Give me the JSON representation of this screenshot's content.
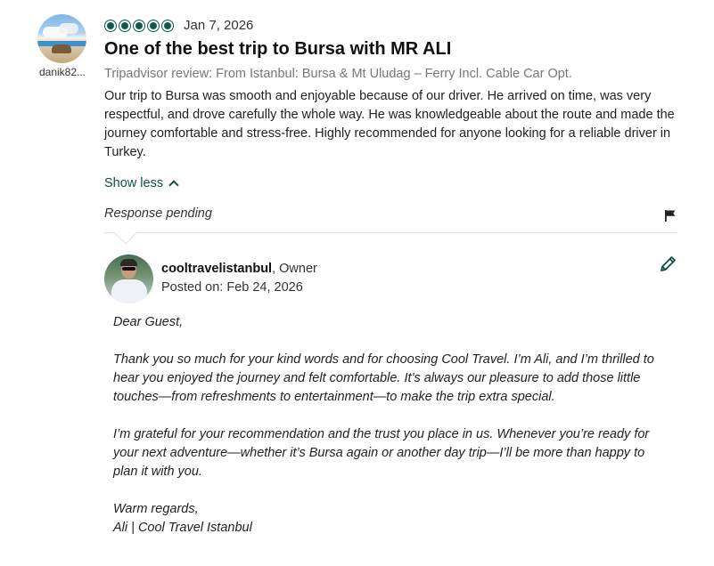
{
  "review": {
    "username": "danik82...",
    "rating": 5,
    "date": "Jan 7, 2026",
    "title": "One of the best trip to Bursa with MR ALI",
    "subtitle": "Tripadvisor review: From Istanbul: Bursa & Mt Uludag – Ferry Incl. Cable Car Opt.",
    "text": "Our trip to Bursa was smooth and enjoyable because of our driver. He arrived on time, was very respectful, and drove carefully the whole way. He was knowledgeable about the route and made the journey comfortable and stress-free. Highly recommended for anyone looking for a reliable driver in Turkey.",
    "show_less_label": "Show less",
    "status": "Response pending"
  },
  "owner_response": {
    "name": "cooltravelistanbul",
    "role": ", Owner",
    "posted": "Posted on: Feb 24, 2026",
    "paragraphs": [
      "Dear Guest,",
      "Thank you so much for your kind words and for choosing Cool Travel. I’m Ali, and I’m thrilled to hear you enjoyed the journey and felt comfortable. It’s always our pleasure to add those little touches—from refreshments to entertainment—to make the trip extra special.",
      "I’m grateful for your recommendation and the trust you place in us. Whenever you’re ready for your next adventure—whether it’s Bursa again or another day trip—I’ll be more than happy to plan it with you.",
      "Warm regards,\nAli | Cool Travel Istanbul"
    ]
  },
  "icons": {
    "flag": "flag-icon",
    "edit": "pencil-icon",
    "chevron": "chevron-up-icon"
  },
  "colors": {
    "accent": "#0f5b4a",
    "link": "#0f4f45"
  }
}
